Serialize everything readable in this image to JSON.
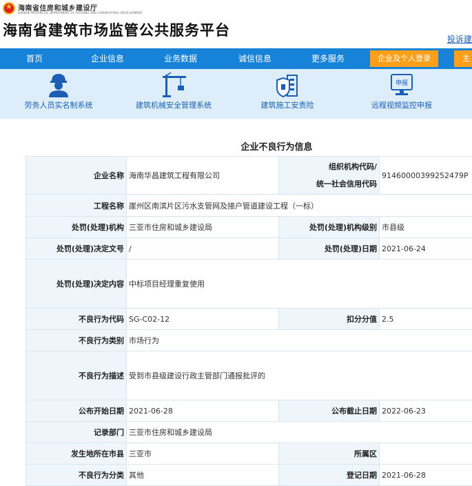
{
  "header": {
    "dept_cn": "海南省住房和城乡建设厅",
    "dept_en": "HAINAN PROVINCIAL DEPARTMENT OF HOUSING AND URBAN-RURAL DEVELOPMENT",
    "site_title": "海南省建筑市场监管公共服务平台",
    "complaint_link": "投诉建"
  },
  "nav": {
    "items": [
      "首页",
      "企业信息",
      "业务数据",
      "诚信信息",
      "更多服务"
    ],
    "login_button": "企业及个人登录",
    "more_button": "主"
  },
  "quick_links": [
    {
      "label": "劳务人员实名制系统",
      "icon": "worker-icon"
    },
    {
      "label": "建筑机械安全管理系统",
      "icon": "crane-icon"
    },
    {
      "label": "建筑施工安责险",
      "icon": "insurance-building-icon"
    },
    {
      "label": "远程视频监控申报",
      "icon": "monitor-report-icon"
    }
  ],
  "icon_badge_text": "申报",
  "section_title": "企业不良行为信息",
  "info": {
    "company_name_label": "企业名称",
    "company_name": "海南华昌建筑工程有限公司",
    "org_code_label_1": "组织机构代码/",
    "org_code_label_2": "统一社会信用代码",
    "org_code": "91460000399252479P",
    "project_name_label": "工程名称",
    "project_name": "崖州区南滨片区污水支管网及接户管道建设工程（一标）",
    "penalty_org_label": "处罚(处理)机构",
    "penalty_org": "三亚市住房和城乡建设局",
    "penalty_org_level_label": "处罚(处理)机构级别",
    "penalty_org_level": "市县级",
    "decision_no_label": "处罚(处理)决定文号",
    "decision_no": "/",
    "penalty_date_label": "处罚(处理)日期",
    "penalty_date": "2021-06-24",
    "decision_content_label": "处罚(处理)决定内容",
    "decision_content": "中标项目经理重复使用",
    "behavior_code_label": "不良行为代码",
    "behavior_code": "SG-C02-12",
    "deduct_label": "扣分分值",
    "deduct": "2.5",
    "behavior_category_label": "不良行为类别",
    "behavior_category": "市场行为",
    "behavior_desc_label": "不良行为描述",
    "behavior_desc": "受到市县级建设行政主管部门通报批评的",
    "publish_start_label": "公布开始日期",
    "publish_start": "2021-06-28",
    "publish_end_label": "公布截止日期",
    "publish_end": "2022-06-23",
    "record_dept_label": "记录部门",
    "record_dept": "三亚市住房和城乡建设局",
    "city_label": "发生地所在市县",
    "city": "三亚市",
    "district_label": "所属区",
    "district": "",
    "classification_label": "不良行为分类",
    "classification": "其他",
    "register_date_label": "登记日期",
    "register_date": "2021-06-28"
  },
  "colors": {
    "nav_bg": "#1682d8",
    "login_bg": "#ff9f1a",
    "quick_bg": "#ddeefa",
    "label_cell_bg": "#eef5fb",
    "link": "#1a5fb4"
  }
}
